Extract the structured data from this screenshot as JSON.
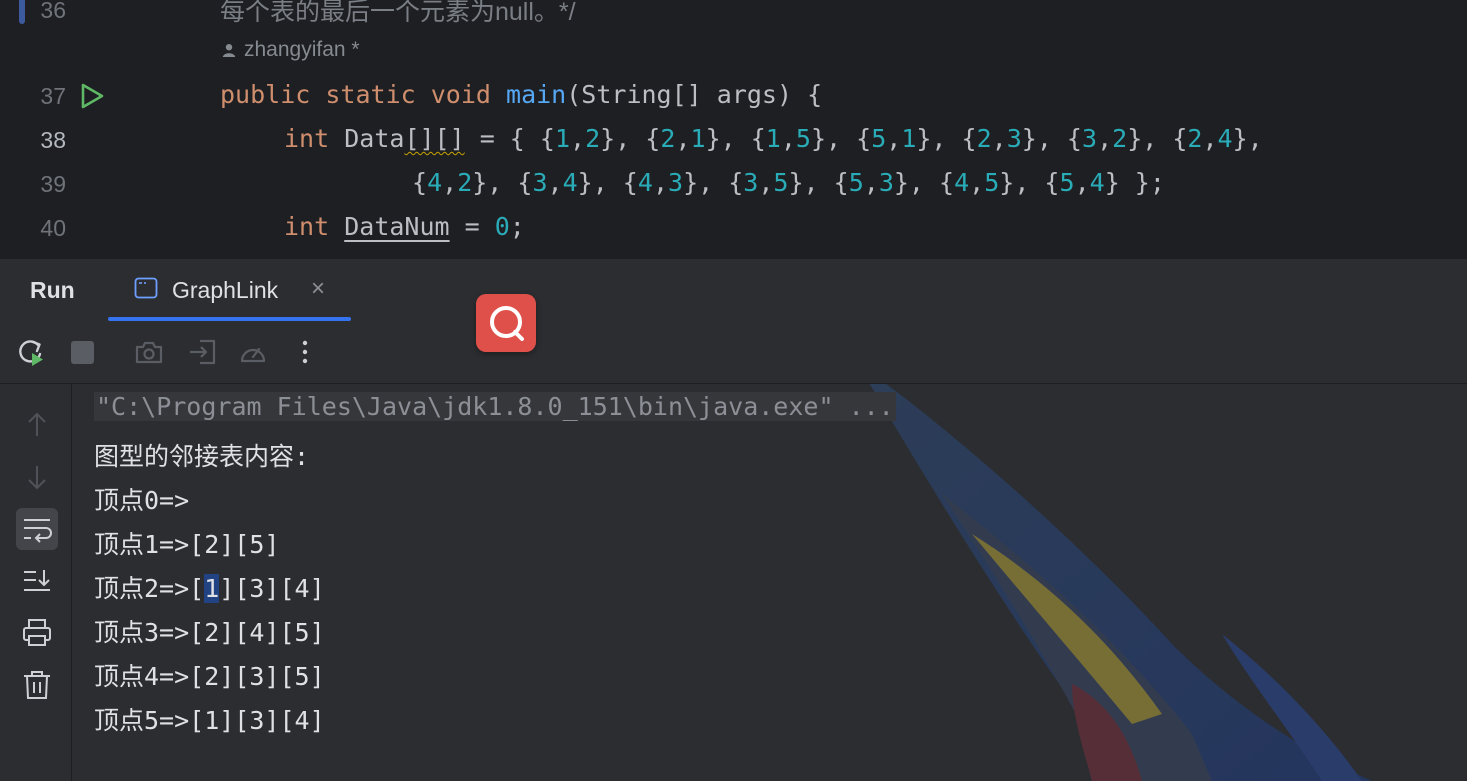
{
  "editor": {
    "lines": [
      {
        "number": "36",
        "comment": "每个表的最后一个元素为null。*/"
      },
      {
        "number": "37"
      },
      {
        "number": "38"
      },
      {
        "number": "39"
      },
      {
        "number": "40"
      }
    ],
    "author_hint": "zhangyifan *",
    "code": {
      "kw_public": "public",
      "kw_static": "static",
      "kw_void": "void",
      "method": "main",
      "signature_rest": "(String[] args) {",
      "kw_int": "int",
      "var_data": "Data",
      "brackets": "[][]",
      "line38_rest": [
        {
          "t": " = { {",
          "c": "p"
        },
        {
          "t": "1",
          "c": "n"
        },
        {
          "t": ",",
          "c": "p"
        },
        {
          "t": "2",
          "c": "n"
        },
        {
          "t": "}, {",
          "c": "p"
        },
        {
          "t": "2",
          "c": "n"
        },
        {
          "t": ",",
          "c": "p"
        },
        {
          "t": "1",
          "c": "n"
        },
        {
          "t": "}, {",
          "c": "p"
        },
        {
          "t": "1",
          "c": "n"
        },
        {
          "t": ",",
          "c": "p"
        },
        {
          "t": "5",
          "c": "n"
        },
        {
          "t": "}, {",
          "c": "p"
        },
        {
          "t": "5",
          "c": "n"
        },
        {
          "t": ",",
          "c": "p"
        },
        {
          "t": "1",
          "c": "n"
        },
        {
          "t": "}, {",
          "c": "p"
        },
        {
          "t": "2",
          "c": "n"
        },
        {
          "t": ",",
          "c": "p"
        },
        {
          "t": "3",
          "c": "n"
        },
        {
          "t": "}, {",
          "c": "p"
        },
        {
          "t": "3",
          "c": "n"
        },
        {
          "t": ",",
          "c": "p"
        },
        {
          "t": "2",
          "c": "n"
        },
        {
          "t": "}, {",
          "c": "p"
        },
        {
          "t": "2",
          "c": "n"
        },
        {
          "t": ",",
          "c": "p"
        },
        {
          "t": "4",
          "c": "n"
        },
        {
          "t": "},",
          "c": "p"
        }
      ],
      "line39": [
        {
          "t": "{",
          "c": "p"
        },
        {
          "t": "4",
          "c": "n"
        },
        {
          "t": ",",
          "c": "p"
        },
        {
          "t": "2",
          "c": "n"
        },
        {
          "t": "}, {",
          "c": "p"
        },
        {
          "t": "3",
          "c": "n"
        },
        {
          "t": ",",
          "c": "p"
        },
        {
          "t": "4",
          "c": "n"
        },
        {
          "t": "}, {",
          "c": "p"
        },
        {
          "t": "4",
          "c": "n"
        },
        {
          "t": ",",
          "c": "p"
        },
        {
          "t": "3",
          "c": "n"
        },
        {
          "t": "}, {",
          "c": "p"
        },
        {
          "t": "3",
          "c": "n"
        },
        {
          "t": ",",
          "c": "p"
        },
        {
          "t": "5",
          "c": "n"
        },
        {
          "t": "}, {",
          "c": "p"
        },
        {
          "t": "5",
          "c": "n"
        },
        {
          "t": ",",
          "c": "p"
        },
        {
          "t": "3",
          "c": "n"
        },
        {
          "t": "}, {",
          "c": "p"
        },
        {
          "t": "4",
          "c": "n"
        },
        {
          "t": ",",
          "c": "p"
        },
        {
          "t": "5",
          "c": "n"
        },
        {
          "t": "}, {",
          "c": "p"
        },
        {
          "t": "5",
          "c": "n"
        },
        {
          "t": ",",
          "c": "p"
        },
        {
          "t": "4",
          "c": "n"
        },
        {
          "t": "} };",
          "c": "p"
        }
      ],
      "var_datanum": "DataNum",
      "line40_eq": " = ",
      "line40_val": "0",
      "line40_end": ";"
    }
  },
  "run_panel": {
    "title": "Run",
    "tab_label": "GraphLink",
    "tab_close": "×"
  },
  "console": {
    "command": "\"C:\\Program Files\\Java\\jdk1.8.0_151\\bin\\java.exe\" ...",
    "header": "图型的邻接表内容:",
    "rows": [
      {
        "prefix": "顶点0=>",
        "selected": "",
        "rest": ""
      },
      {
        "prefix": "顶点1=>[2][5]",
        "selected": "",
        "rest": ""
      },
      {
        "prefix": "顶点2=>[",
        "selected": "1",
        "rest": "][3][4]"
      },
      {
        "prefix": "顶点3=>[2][4][5]",
        "selected": "",
        "rest": ""
      },
      {
        "prefix": "顶点4=>[2][3][5]",
        "selected": "",
        "rest": ""
      },
      {
        "prefix": "顶点5=>[1][3][4]",
        "selected": "",
        "rest": ""
      }
    ]
  },
  "colors": {
    "keyword": "#cf8e6d",
    "method": "#56a8f5",
    "number": "#2aacb8",
    "accent": "#3574f0",
    "run_green": "#5fb865",
    "selection": "#214283"
  },
  "icons": {
    "toolbar": [
      "rerun-icon",
      "stop-icon",
      "screenshot-icon",
      "exit-icon",
      "coverage-icon",
      "more-icon"
    ],
    "leftbar": [
      "arrow-up-icon",
      "arrow-down-icon",
      "soft-wrap-icon",
      "scroll-to-end-icon",
      "print-icon",
      "trash-icon"
    ]
  }
}
